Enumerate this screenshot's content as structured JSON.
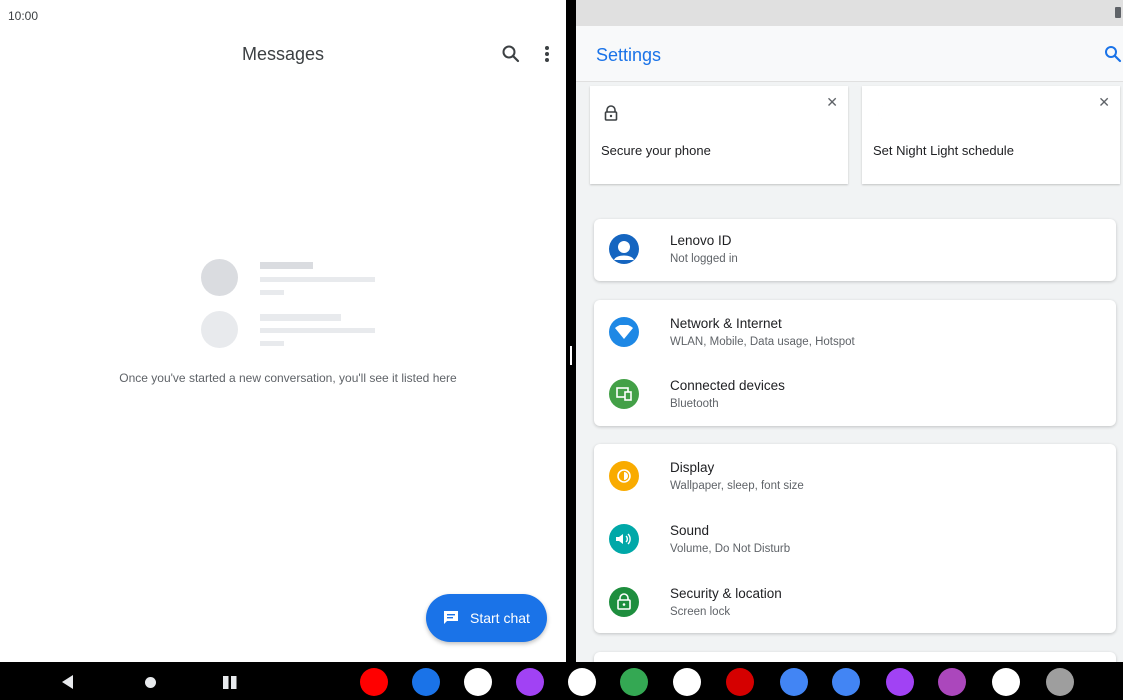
{
  "status": {
    "time": "10:00"
  },
  "messages": {
    "title": "Messages",
    "empty_text": "Once you've started a new conversation, you'll see it listed here",
    "fab_label": "Start chat"
  },
  "settings": {
    "title": "Settings",
    "suggestions": [
      {
        "label": "Secure your phone",
        "icon": "lock-icon"
      },
      {
        "label": "Set Night Light schedule",
        "icon": "moon-icon"
      }
    ],
    "account": {
      "title": "Lenovo ID",
      "subtitle": "Not logged in"
    },
    "network": {
      "title": "Network & Internet",
      "subtitle": "WLAN, Mobile, Data usage, Hotspot"
    },
    "devices": {
      "title": "Connected devices",
      "subtitle": "Bluetooth"
    },
    "display": {
      "title": "Display",
      "subtitle": "Wallpaper, sleep, font size"
    },
    "sound": {
      "title": "Sound",
      "subtitle": "Volume, Do Not Disturb"
    },
    "security": {
      "title": "Security & location",
      "subtitle": "Screen lock"
    }
  },
  "colors": {
    "accent": "#1a73e8",
    "account": "#1565c0",
    "network": "#1e88e5",
    "devices": "#43a047",
    "display": "#f9ab00",
    "sound": "#00a8a8",
    "security": "#1e8e3e"
  },
  "dock": [
    {
      "name": "youtube-icon",
      "color": "#ff0000"
    },
    {
      "name": "meet-icon",
      "color": "#1a73e8"
    },
    {
      "name": "photos-icon",
      "color": "#ffffff"
    },
    {
      "name": "tips-icon",
      "color": "#a142f4"
    },
    {
      "name": "gmail-icon",
      "color": "#ffffff"
    },
    {
      "name": "maps-icon",
      "color": "#34a853"
    },
    {
      "name": "drive-icon",
      "color": "#ffffff"
    },
    {
      "name": "play-music-icon",
      "color": "#d50000"
    },
    {
      "name": "gallery-icon",
      "color": "#4285f4"
    },
    {
      "name": "contacts-icon",
      "color": "#4285f4"
    },
    {
      "name": "notes-icon",
      "color": "#a142f4"
    },
    {
      "name": "recorder-icon",
      "color": "#ab47bc"
    },
    {
      "name": "screen-record-icon",
      "color": "#ffffff"
    },
    {
      "name": "settings-gear-icon",
      "color": "#9e9e9e"
    }
  ]
}
